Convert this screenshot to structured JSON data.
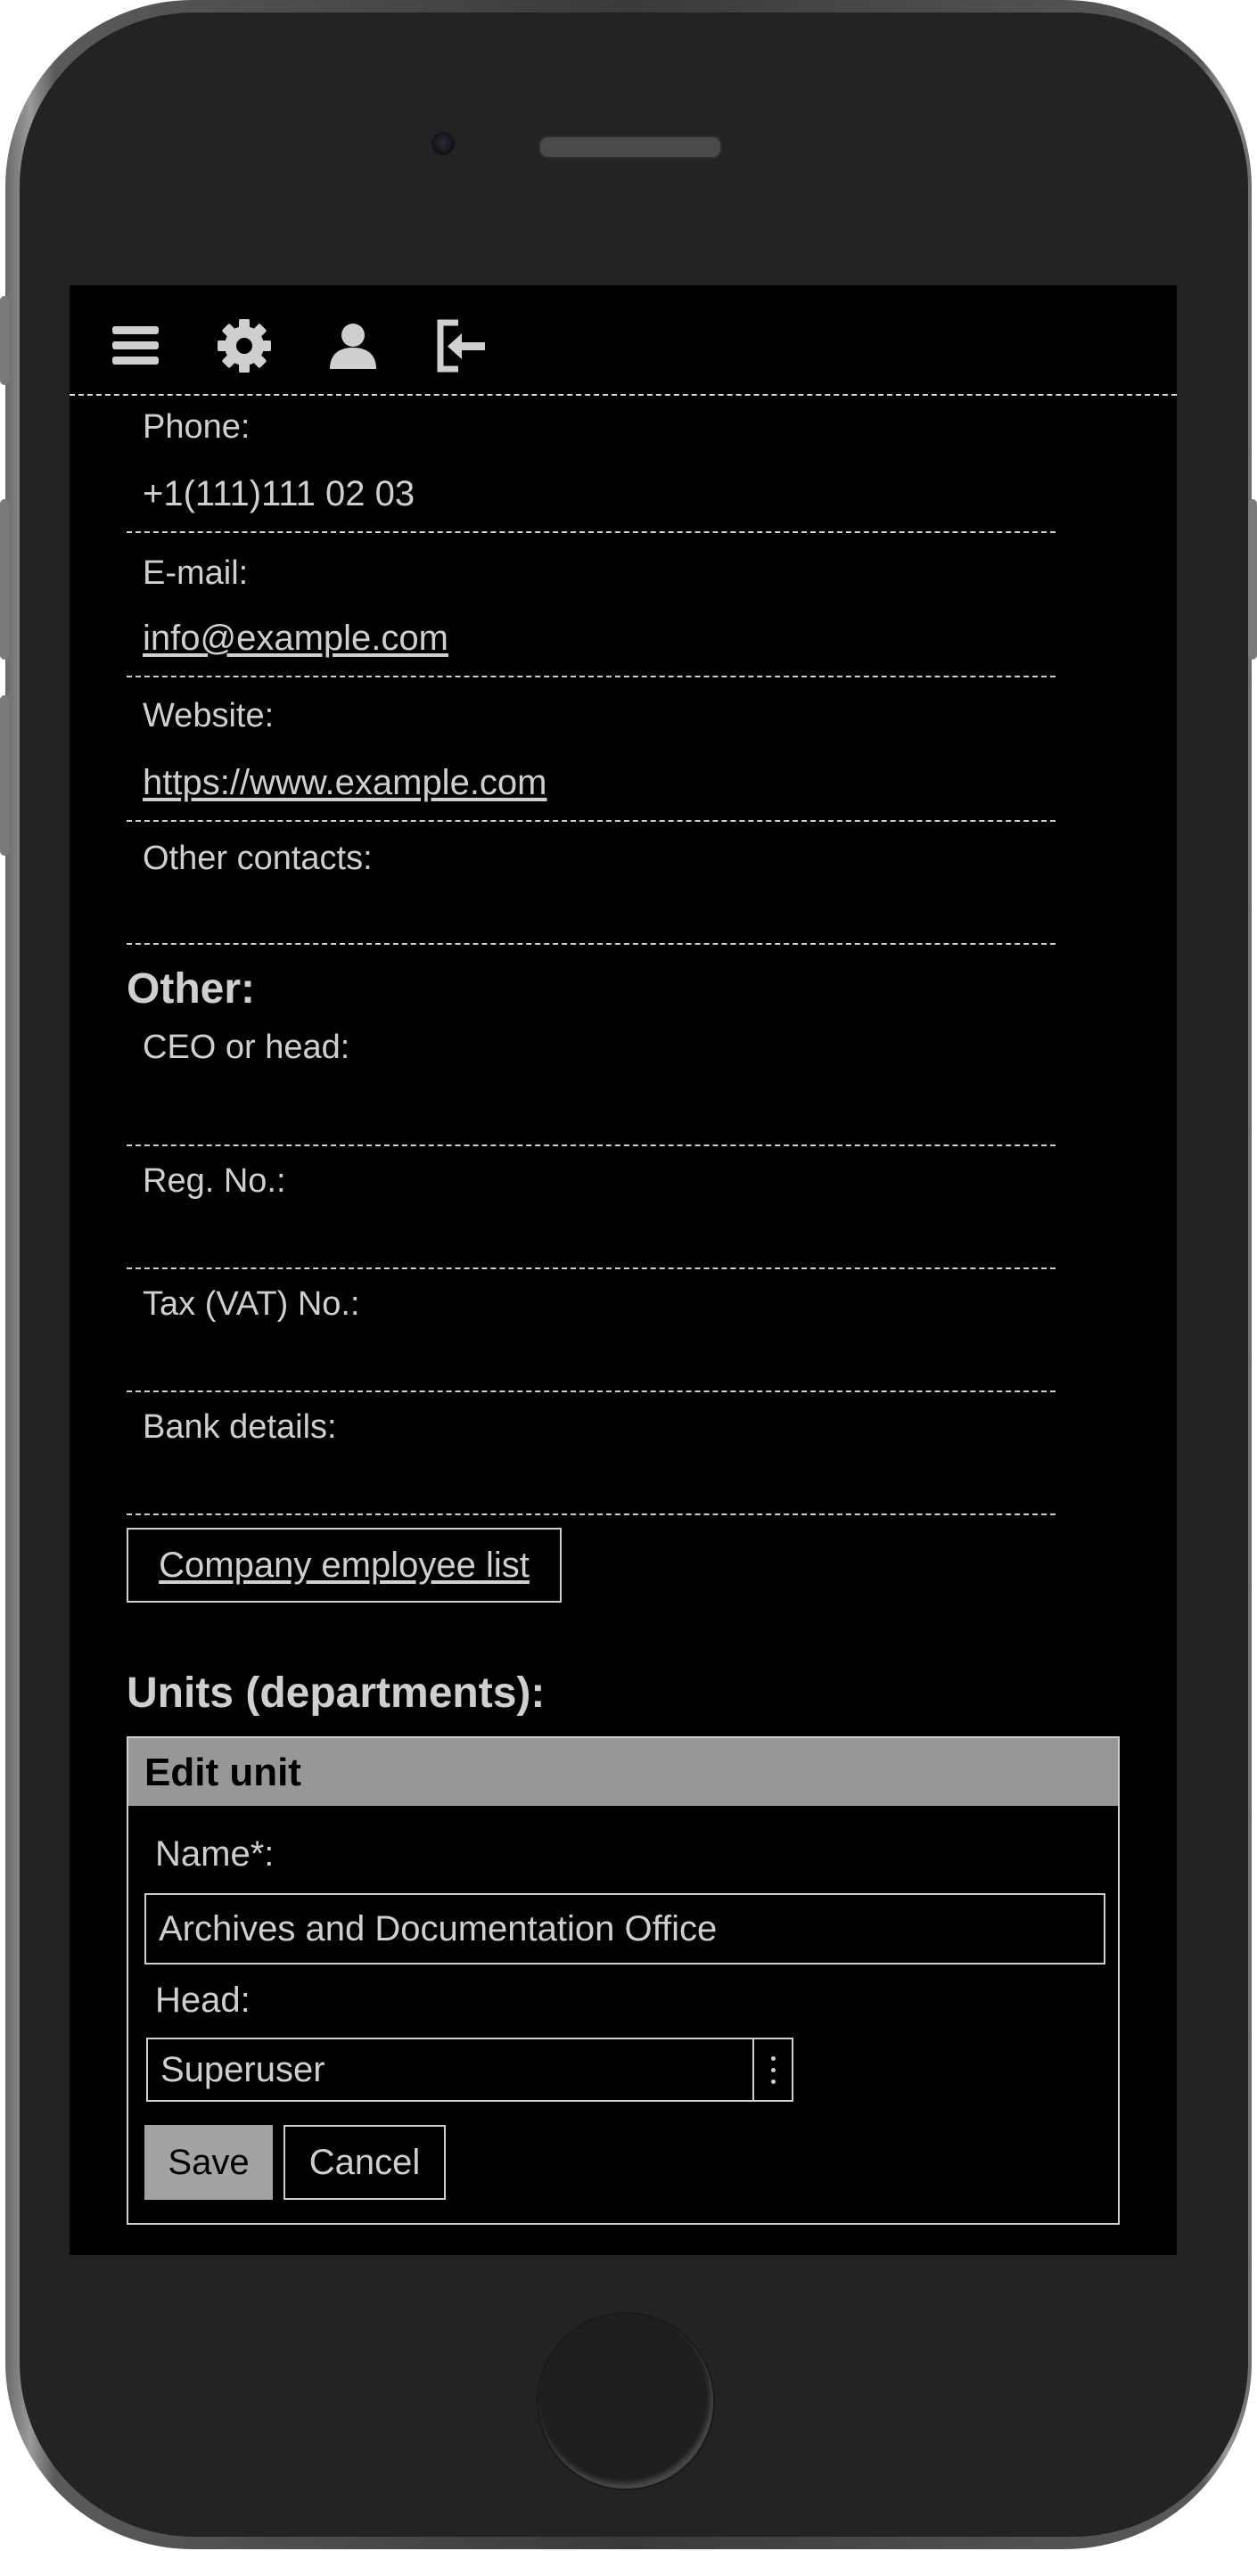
{
  "toolbar": {
    "icons": [
      "menu-icon",
      "gear-icon",
      "user-icon",
      "logout-icon"
    ]
  },
  "contacts": {
    "phone": {
      "label": "Phone:",
      "value": "+1(111)111 02 03"
    },
    "email": {
      "label": "E-mail:",
      "value": "info@example.com"
    },
    "website": {
      "label": "Website:",
      "value": "https://www.example.com"
    },
    "other_contacts": {
      "label": "Other contacts:",
      "value": ""
    }
  },
  "other": {
    "heading": "Other:",
    "ceo": {
      "label": "CEO or head:",
      "value": ""
    },
    "reg_no": {
      "label": "Reg. No.:",
      "value": ""
    },
    "tax_no": {
      "label": "Tax (VAT) No.:",
      "value": ""
    },
    "bank": {
      "label": "Bank details:",
      "value": ""
    },
    "employee_list_button": "Company employee list"
  },
  "units": {
    "heading": "Units (departments):",
    "edit_panel": {
      "title": "Edit unit",
      "name_label": "Name*:",
      "name_value": "Archives and Documentation Office",
      "head_label": "Head:",
      "head_value": "Superuser",
      "save_label": "Save",
      "cancel_label": "Cancel"
    }
  },
  "colors": {
    "screen_bg": "#000000",
    "text": "#cfcfcf",
    "panel_header": "#979797",
    "save_button": "#a3a3a3"
  }
}
